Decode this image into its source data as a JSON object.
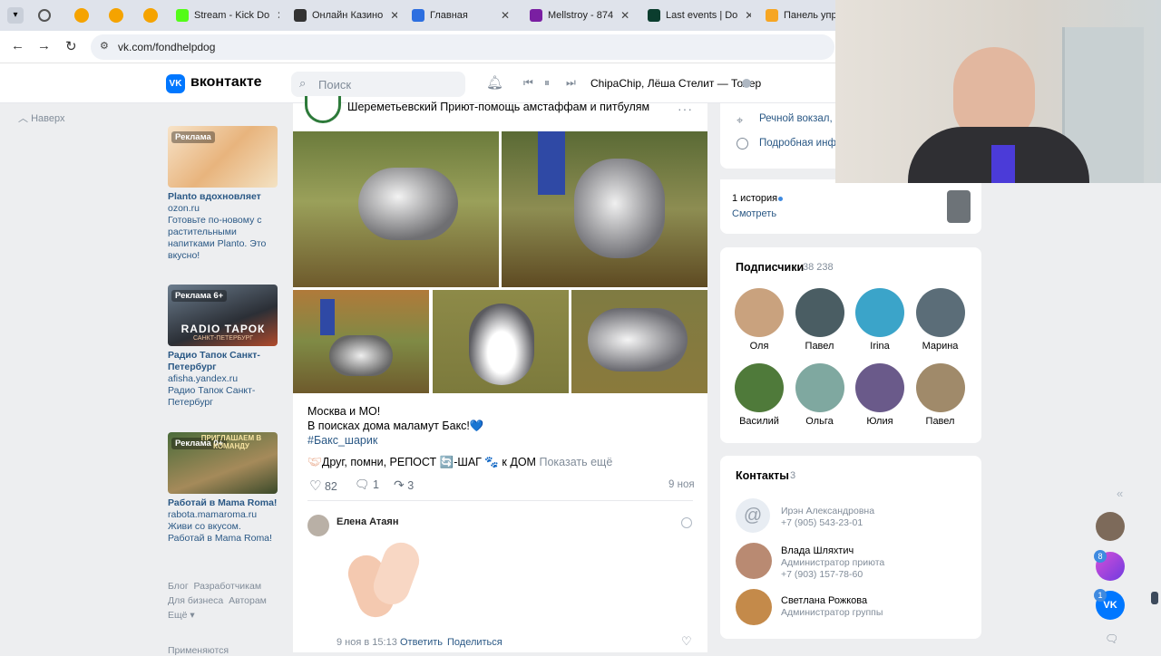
{
  "browser": {
    "tabs": [
      {
        "title": "Stream - Kick Do",
        "color": "#53fc18"
      },
      {
        "title": "Онлайн Казино",
        "color": "#333"
      },
      {
        "title": "Главная",
        "color": "#2d6fe0"
      },
      {
        "title": "Mellstroy - 874",
        "color": "#7a1fa2"
      },
      {
        "title": "Last events | Do",
        "color": "#0b3d2e"
      },
      {
        "title": "Панель управ",
        "color": "#f6a623"
      }
    ],
    "url": "vk.com/fondhelpdog"
  },
  "header": {
    "logo_text": "вконтакте",
    "search_placeholder": "Поиск",
    "now_playing": "ChipaChip, Лёша Стелит — Толер"
  },
  "left": {
    "back_label": "Наверх",
    "ads": [
      {
        "badge": "Реклама",
        "title": "Planto вдохновляет",
        "domain": "ozon.ru",
        "text": "Готовьте по-новому с растительными напитками Planto. Это вкусно!"
      },
      {
        "badge": "Реклама 6+",
        "title": "Радио Тапок Санкт-Петербург",
        "domain": "afisha.yandex.ru",
        "text": "Радио Тапок Санкт-Петербург",
        "banner": "RADIO ТАРОК",
        "banner_sub": "САНКТ-ПЕТЕРБУРГ"
      },
      {
        "badge": "Реклама 0+",
        "title": "Работай в Mama Roma!",
        "domain": "rabota.mamaroma.ru",
        "text": "Живи со вкусом. Работай в Mama Roma!",
        "banner": "ПРИГЛАШАЕМ В КОМАНДУ"
      }
    ],
    "footer": [
      "Блог",
      "Разработчикам",
      "Для бизнеса",
      "Авторам",
      "Ещё"
    ],
    "footer_cut": "Применяются"
  },
  "post": {
    "author": "Шереметьевский Приют-помощь амстаффам и питбулям",
    "line1": "Москва и МО!",
    "line2": "В поисках дома маламут Бакс!💙",
    "hashtag": "#Бакс_шарик",
    "line3": "Друг, помни, РЕПОСТ 🔄-ШАГ 🐾 к ДОМ",
    "show_more": "Показать ещё",
    "likes": "82",
    "comments": "1",
    "shares": "3",
    "date": "9 ноя",
    "comment": {
      "author": "Елена Атаян",
      "time": "9 ноя в 15:13",
      "reply": "Ответить",
      "share": "Поделиться"
    }
  },
  "right": {
    "place": "Речной вокзал, М",
    "details": "Подробная инфо",
    "stories_count": "1 история",
    "stories_watch": "Смотреть",
    "subs_title": "Подписчики",
    "subs_count": "38 238",
    "subscribers": [
      {
        "name": "Оля",
        "color": "#c9a27e"
      },
      {
        "name": "Павел",
        "color": "#4a5d63"
      },
      {
        "name": "Irina",
        "color": "#3ba4c9"
      },
      {
        "name": "Марина",
        "color": "#5b6d78"
      },
      {
        "name": "Василий",
        "color": "#4f7a3a"
      },
      {
        "name": "Ольга",
        "color": "#7fa8a0"
      },
      {
        "name": "Юлия",
        "color": "#6a5a8a"
      },
      {
        "name": "Павел",
        "color": "#a08a6a"
      }
    ],
    "contacts_title": "Контакты",
    "contacts_count": "3",
    "contacts": [
      {
        "name": "Ирэн Александровна",
        "info": "+7 (905) 543-23-01"
      },
      {
        "name": "Влада Шляхтич",
        "role": "Администратор приюта",
        "info": "+7 (903) 157-78-60"
      },
      {
        "name": "Светлана Рожкова",
        "role": "Администратор группы"
      }
    ]
  },
  "sidebar_badges": {
    "a": "8",
    "b": "1"
  }
}
